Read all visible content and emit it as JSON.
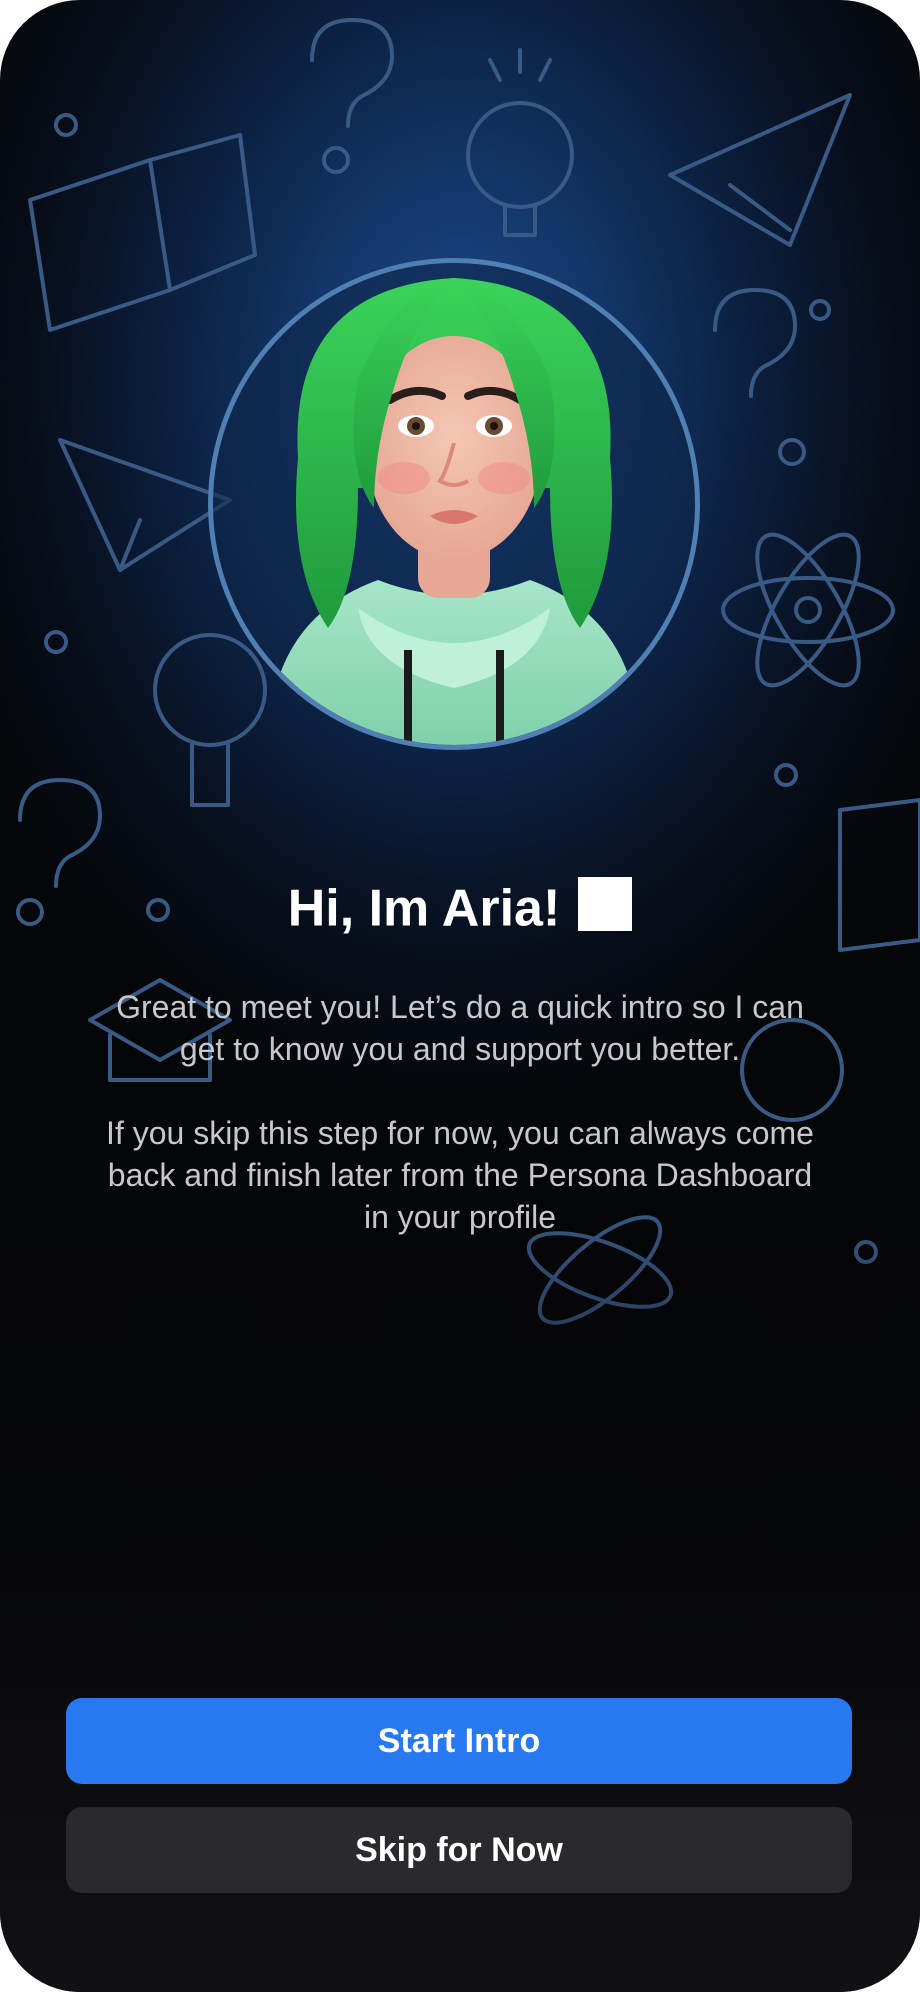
{
  "onboarding": {
    "greeting": "Hi, Im Aria!",
    "intro_paragraph": "Great to meet you! Let’s do a quick intro so I can get to know you and support you better.",
    "skip_paragraph": "If you skip this step for now, you can always come back and finish later from the Persona Dashboard in your profile"
  },
  "actions": {
    "start_label": "Start Intro",
    "skip_label": "Skip for Now"
  },
  "colors": {
    "primary_button": "#2878f0",
    "secondary_button": "#2a2a2c",
    "background_glow": "#1c4a8c",
    "avatar_ring": "#4f7fb3",
    "hair": "#2fb34a",
    "hoodie": "#8fd9b6"
  },
  "icons": {
    "wave_emoji": "wave-emoji-placeholder"
  }
}
